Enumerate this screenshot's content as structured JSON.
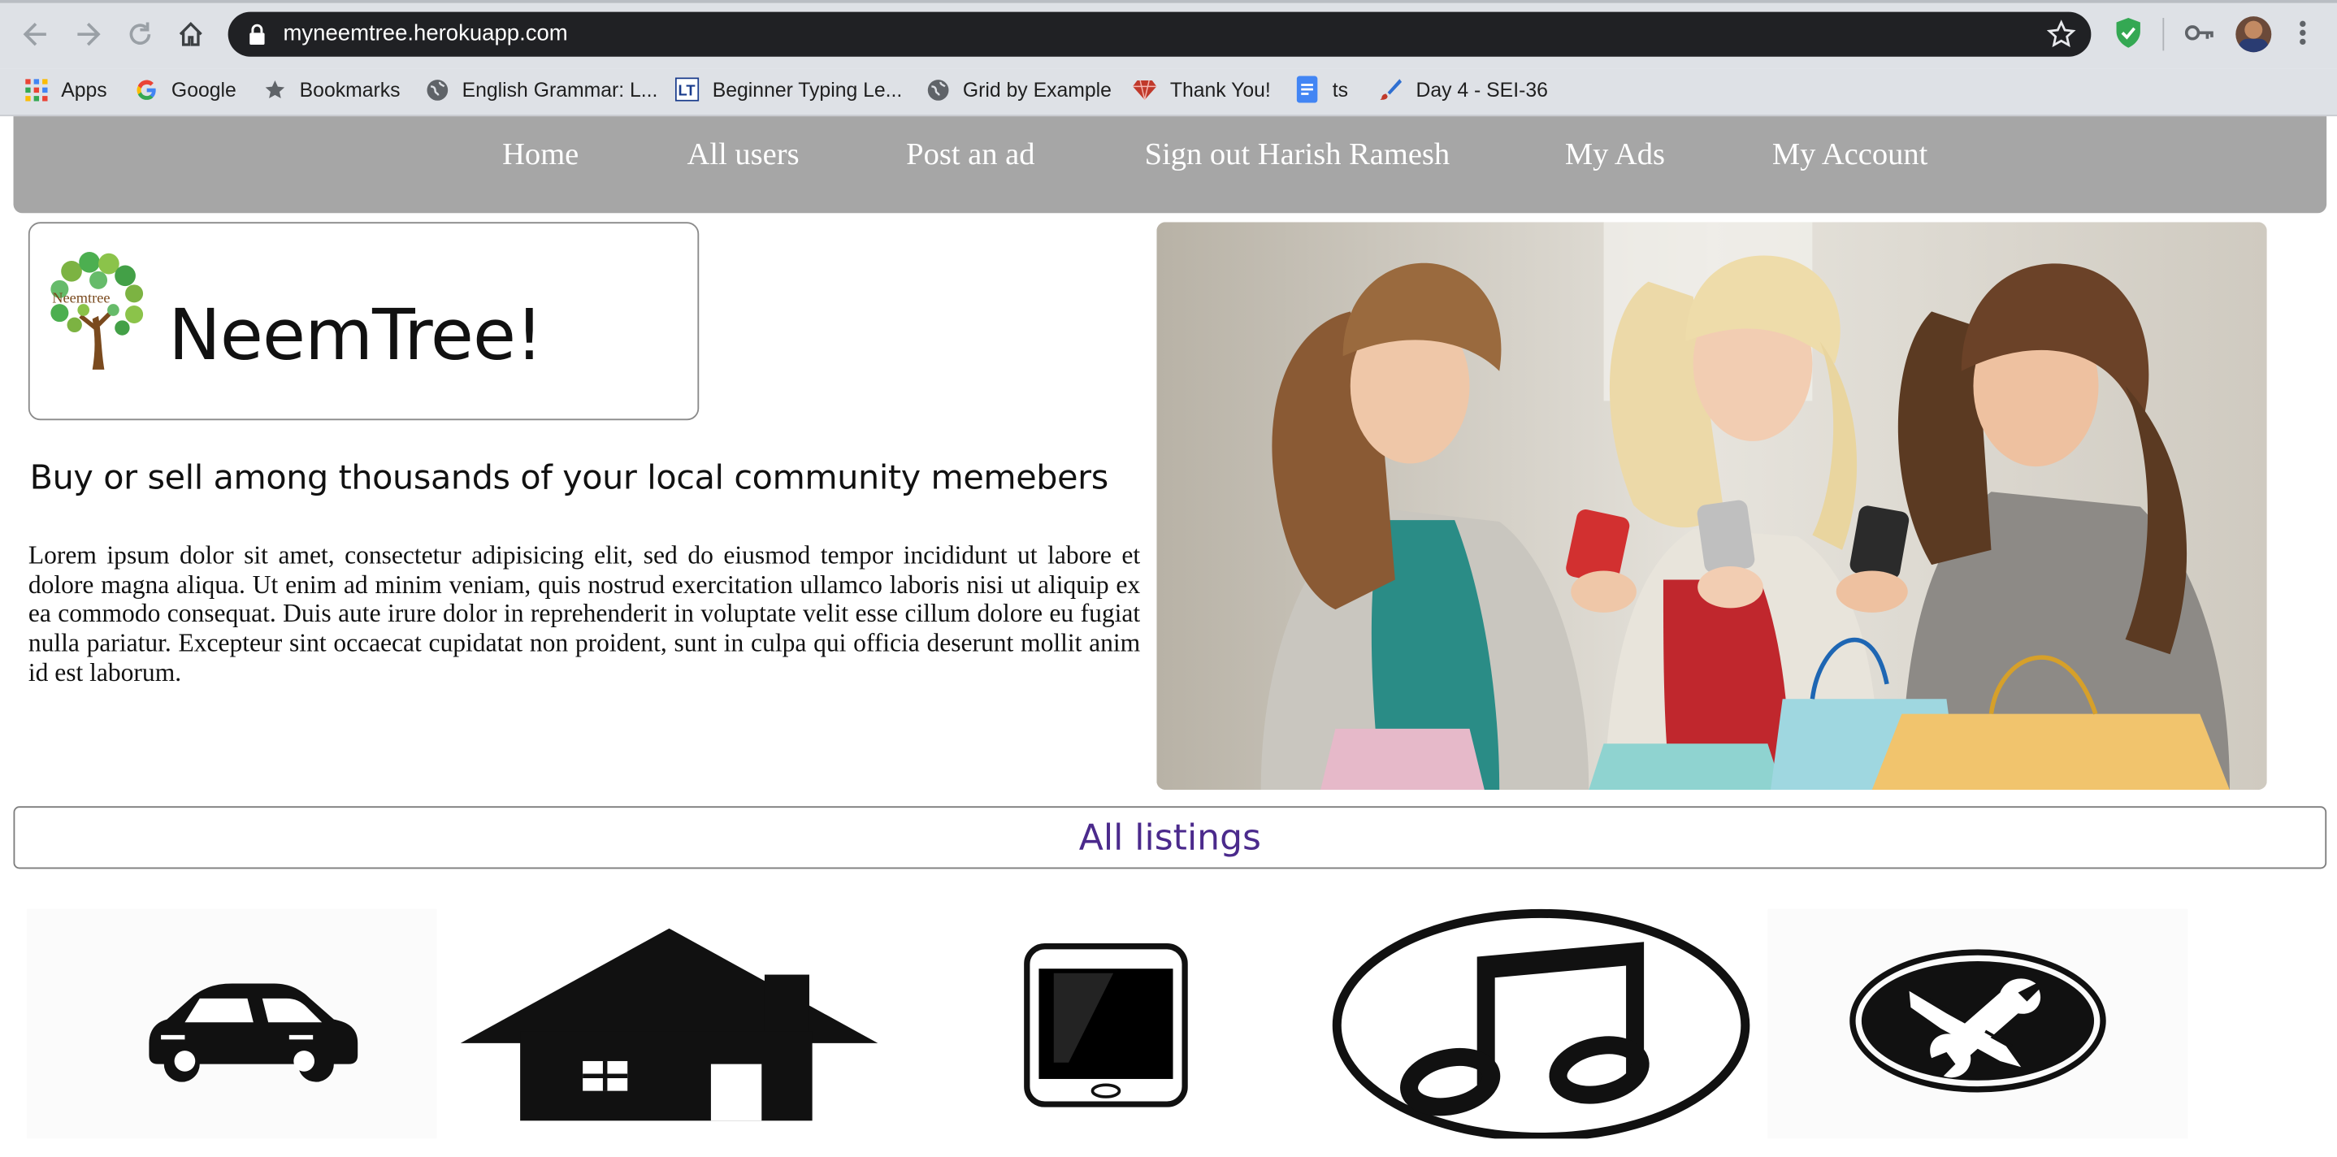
{
  "browser": {
    "url": "myneemtree.herokuapp.com",
    "bookmarks": [
      {
        "label": "Apps",
        "icon": "apps-grid-icon"
      },
      {
        "label": "Google",
        "icon": "google-g-icon"
      },
      {
        "label": "Bookmarks",
        "icon": "star-icon"
      },
      {
        "label": "English Grammar: L...",
        "icon": "globe-icon"
      },
      {
        "label": "Beginner Typing Le...",
        "icon": "lt-logo-icon"
      },
      {
        "label": "Grid by Example",
        "icon": "globe-icon"
      },
      {
        "label": "Thank You!",
        "icon": "gem-icon"
      },
      {
        "label": "ts",
        "icon": "docs-icon"
      },
      {
        "label": "Day 4 - SEI-36",
        "icon": "brush-icon"
      }
    ]
  },
  "nav": {
    "items": [
      "Home",
      "All users",
      "Post an ad",
      "Sign out Harish Ramesh",
      "My Ads",
      "My Account"
    ]
  },
  "brand": {
    "name": "NeemTree!",
    "logo_text": "Neemtree"
  },
  "hero": {
    "tagline": "Buy or sell among thousands of your local community memebers",
    "body": "Lorem ipsum dolor sit amet, consectetur adipisicing elit, sed do eiusmod tempor incididunt ut labore et dolore magna aliqua. Ut enim ad minim veniam, quis nostrud exercitation ullamco laboris nisi ut aliquip ex ea commodo consequat. Duis aute irure dolor in reprehenderit in voluptate velit esse cillum dolore eu fugiat nulla pariatur. Excepteur sint occaecat cupidatat non proident, sunt in culpa qui officia deserunt mollit anim id est laborum."
  },
  "listings": {
    "title": "All listings",
    "categories": [
      "car-icon",
      "house-icon",
      "phone-icon",
      "music-icon",
      "tools-icon"
    ]
  },
  "colors": {
    "navbar_bg": "#a6a6a6",
    "listings_title": "#4b2a8c",
    "omnibox_bg": "#202124"
  }
}
